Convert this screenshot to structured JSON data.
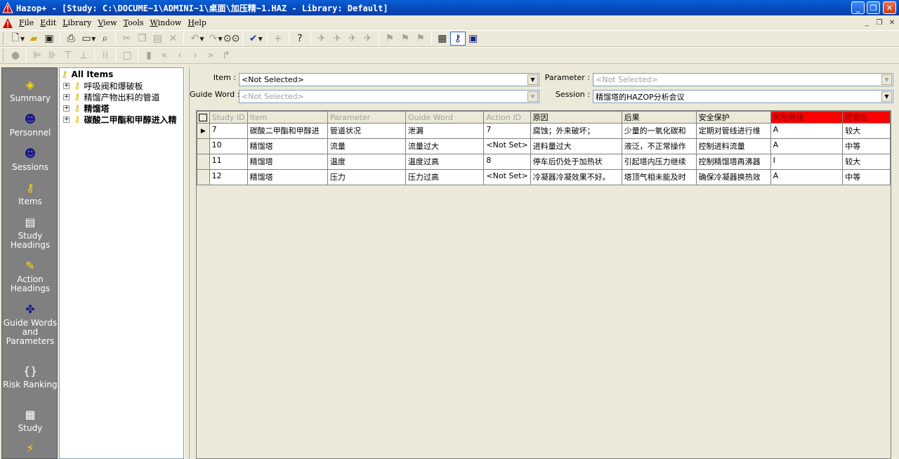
{
  "window": {
    "title": "Hazop+ - [Study: C:\\DOCUME~1\\ADMINI~1\\桌面\\加压精~1.HAZ - Library: Default]",
    "minimize": "_",
    "maximize": "❐",
    "close": "✕"
  },
  "menu": [
    {
      "u": "F",
      "rest": "ile"
    },
    {
      "u": "E",
      "rest": "dit"
    },
    {
      "u": "L",
      "rest": "ibrary"
    },
    {
      "u": "V",
      "rest": "iew"
    },
    {
      "u": "T",
      "rest": "ools"
    },
    {
      "u": "W",
      "rest": "indow"
    },
    {
      "u": "H",
      "rest": "elp"
    }
  ],
  "nav": [
    {
      "label": "Summary",
      "icon": "summary-icon",
      "glyph": "◈"
    },
    {
      "label": "Personnel",
      "icon": "person-icon",
      "glyph": "☻"
    },
    {
      "label": "Sessions",
      "icon": "group-icon",
      "glyph": "☻"
    },
    {
      "label": "Items",
      "icon": "key-icon",
      "glyph": "⚷"
    },
    {
      "label": "Study Headings",
      "icon": "book-icon",
      "glyph": "▤"
    },
    {
      "label": "Action Headings",
      "icon": "pencil-note-icon",
      "glyph": "✎"
    },
    {
      "label": "Guide Words and Parameters",
      "icon": "guide-icon",
      "glyph": "✤"
    },
    {
      "label": "Risk Ranking",
      "icon": "brackets-icon",
      "glyph": "{}"
    },
    {
      "label": "Study",
      "icon": "study-book-icon",
      "glyph": "▦"
    }
  ],
  "tree": [
    {
      "label": "All Items",
      "bold": true,
      "expander": ""
    },
    {
      "label": "呼吸阀和爆破板",
      "bold": false,
      "expander": "+"
    },
    {
      "label": "精馏产物出料的管道",
      "bold": false,
      "expander": "+"
    },
    {
      "label": "精馏塔",
      "bold": true,
      "expander": "+"
    },
    {
      "label": "碳酸二甲酯和甲醇进入精",
      "bold": true,
      "expander": "+"
    }
  ],
  "filters": {
    "item_label": "Item :",
    "item_value": "<Not Selected>",
    "guide_label": "Guide Word :",
    "guide_value": "<Not Selected>",
    "parameter_label": "Parameter :",
    "parameter_value": "<Not Selected>",
    "session_label": "Session :",
    "session_value": "精馏塔的HAZOP分析会议"
  },
  "grid": {
    "columns": [
      "Study ID",
      "Item",
      "Parameter",
      "Guide Word",
      "Action ID",
      "原因",
      "后果",
      "安全保护",
      "风险等级",
      "可能性"
    ],
    "rows": [
      [
        "7",
        "碳酸二甲酯和甲醇进",
        "管道状况",
        "泄漏",
        "7",
        "腐蚀；外来破坏；",
        "少量的一氧化碳和",
        "定期对管线进行维",
        "A",
        "较大"
      ],
      [
        "10",
        "精馏塔",
        "流量",
        "流量过大",
        "<Not Set>",
        "进料量过大",
        "液泛，不正常操作",
        "控制进料流量",
        "A",
        "中等"
      ],
      [
        "11",
        "精馏塔",
        "温度",
        "温度过高",
        "8",
        "停车后仍处于加热状",
        "引起塔内压力继续",
        "控制精馏塔再沸器",
        "I",
        "较大"
      ],
      [
        "12",
        "精馏塔",
        "压力",
        "压力过高",
        "<Not Set>",
        "冷凝器冷凝效果不好。",
        "塔顶气相未能及时",
        "确保冷凝器换热效",
        "A",
        "中等"
      ]
    ]
  }
}
